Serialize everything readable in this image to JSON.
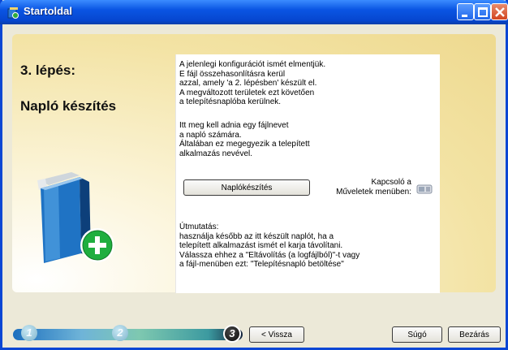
{
  "window": {
    "title": "Startoldal",
    "title_icon": "app-icon",
    "controls": [
      "minimize-icon",
      "maximize-icon",
      "close-icon"
    ]
  },
  "step": {
    "title": "3. lépés:",
    "subtitle": "Napló készítés"
  },
  "panel": {
    "paragraph1": "A jelenlegi konfigurációt ismét elmentjük.\nE fájl összehasonlításra kerül\nazzal, amely 'a 2. lépésben' készült el.\nA megváltozott területek ezt követően\na telepítésnaplóba kerülnek.",
    "paragraph2": "Itt meg kell adnia egy fájlnevet\na napló számára.\nÁltalában ez megegyezik a telepített\nalkalmazás nevével.",
    "create_log_button": "Naplókészítés",
    "switch_label": "Kapcsoló a\nMűveletek menüben:",
    "switch_icon": "toggle-icon",
    "hint": "Útmutatás:\nhasználja később az itt készült naplót, ha a\ntelepített alkalmazást ismét el karja távolítani.\nVálassza ehhez a \"Eltávolítás (a logfájlból)\"-t vagy\na fájl-menüben ezt: \"Telepítésnapló betöltése\""
  },
  "progress": {
    "steps": [
      "1",
      "2",
      "3"
    ],
    "current": 3
  },
  "buttons": {
    "back": "< Vissza",
    "help": "Súgó",
    "close": "Bezárás"
  }
}
